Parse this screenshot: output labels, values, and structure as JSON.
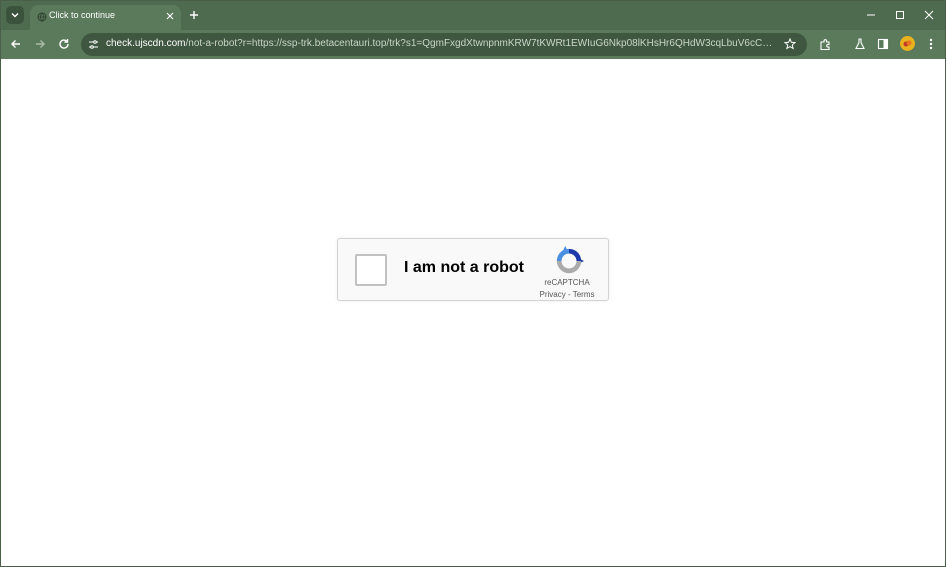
{
  "browser": {
    "tab": {
      "title": "Click to continue"
    },
    "address_bar": {
      "host": "check.ujscdn.com",
      "path": "/not-a-robot?r=https://ssp-trk.betacentauri.top/trk?s1=QgmFxgdXtwnpnmKRW7tKWRt1EWIuG6Nkp08lKHsHr6QHdW3cqLbuV6cCwxxZsTZAkA9jY..."
    }
  },
  "captcha": {
    "label": "I am not a robot",
    "brand": "reCAPTCHA",
    "privacy_label": "Privacy",
    "separator": " - ",
    "terms_label": "Terms"
  },
  "colors": {
    "frame": "#4e6a4f",
    "toolbar": "#5a7a5b",
    "omnibox": "#3f5740",
    "recaptcha_blue": "#1c3aa9",
    "recaptcha_lightblue": "#4a90e2",
    "recaptcha_gray": "#ababab"
  },
  "icons": {
    "tab_search": "chevron-down-icon",
    "tab_close": "close-icon",
    "new_tab": "plus-icon",
    "back": "back-arrow-icon",
    "forward": "forward-arrow-icon",
    "reload": "reload-icon",
    "site_info": "site-info-icon",
    "bookmark": "star-icon",
    "extensions": "puzzle-icon",
    "labs": "flask-icon",
    "side_panel": "side-panel-icon",
    "menu": "kebab-menu-icon",
    "minimize": "minimize-icon",
    "maximize": "maximize-icon",
    "close": "close-icon"
  }
}
